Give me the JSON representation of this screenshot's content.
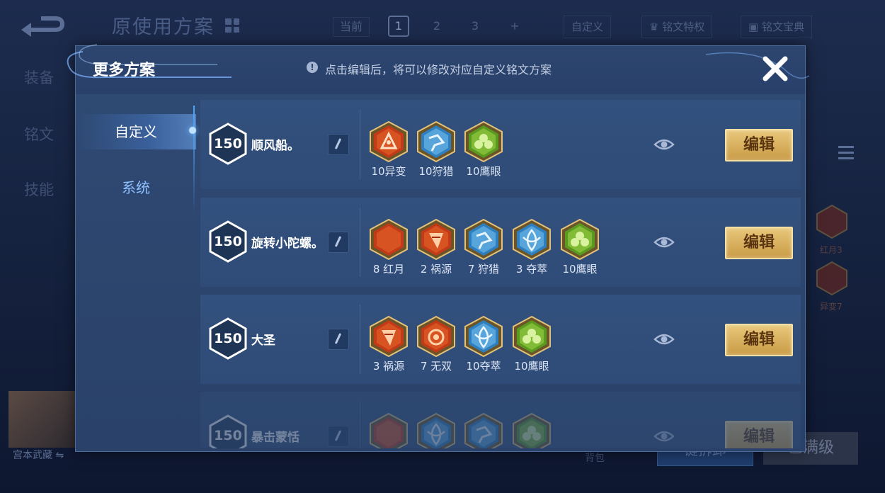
{
  "background": {
    "title": "原使用方案",
    "current_label": "当前",
    "slots": [
      "1",
      "2",
      "3",
      "+"
    ],
    "custom_tab": "自定义",
    "privilege_tab": "铭文特权",
    "codex_tab": "铭文宝典",
    "side_menu": [
      "装备",
      "铭文",
      "技能"
    ],
    "hero_name": "宫本武藏",
    "right_runes": [
      "红月3",
      "异变7"
    ],
    "bag_label": "背包",
    "btn_blue": "键拆卸",
    "btn_grey": "已满级"
  },
  "modal": {
    "title": "更多方案",
    "hint": "点击编辑后，将可以修改对应自定义铭文方案",
    "tabs": [
      "自定义",
      "系统"
    ],
    "edit_label": "编辑",
    "schemes": [
      {
        "level": "150",
        "name": "顺风船。",
        "runes": [
          {
            "label": "10异变",
            "icon": "red-mutation-rune"
          },
          {
            "label": "10狩猎",
            "icon": "blue-hunt-rune"
          },
          {
            "label": "10鹰眼",
            "icon": "green-hawkeye-rune"
          }
        ]
      },
      {
        "level": "150",
        "name": "旋转小陀螺。",
        "runes": [
          {
            "label": "8 红月",
            "icon": "red-moon-rune"
          },
          {
            "label": "2 祸源",
            "icon": "red-calamity-rune"
          },
          {
            "label": "7 狩猎",
            "icon": "blue-hunt-rune"
          },
          {
            "label": "3 夺萃",
            "icon": "blue-plunder-rune"
          },
          {
            "label": "10鹰眼",
            "icon": "green-hawkeye-rune"
          }
        ]
      },
      {
        "level": "150",
        "name": "大圣",
        "runes": [
          {
            "label": "3 祸源",
            "icon": "red-calamity-rune"
          },
          {
            "label": "7 无双",
            "icon": "red-peerless-rune"
          },
          {
            "label": "10夺萃",
            "icon": "blue-plunder-rune"
          },
          {
            "label": "10鹰眼",
            "icon": "green-hawkeye-rune"
          }
        ]
      },
      {
        "level": "150",
        "name": "暴击蒙恬",
        "runes": [
          {
            "label": "",
            "icon": "red-moon-rune"
          },
          {
            "label": "",
            "icon": "blue-plunder-rune"
          },
          {
            "label": "",
            "icon": "blue-hunt-rune"
          },
          {
            "label": "",
            "icon": "green-hawkeye-rune"
          }
        ]
      }
    ]
  },
  "colors": {
    "red_rune": "#d2441b",
    "blue_rune": "#4a9fd8",
    "green_rune": "#7cbc2e",
    "gold_button": "#d9b15f"
  }
}
